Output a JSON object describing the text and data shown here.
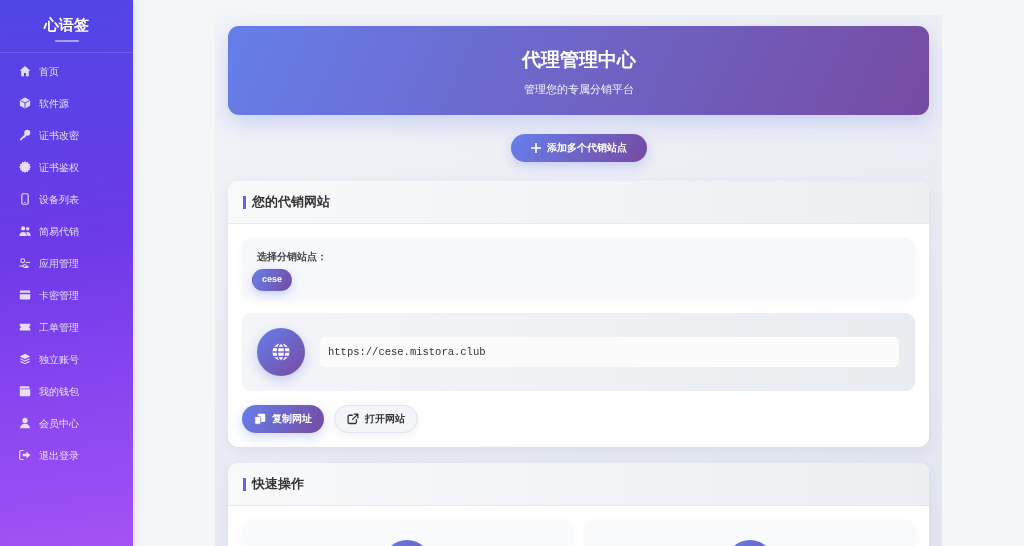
{
  "sidebar": {
    "brand": "心语签",
    "items": [
      {
        "label": "首页",
        "selected": false
      },
      {
        "label": "软件源",
        "selected": false
      },
      {
        "label": "证书改密",
        "selected": false
      },
      {
        "label": "证书鉴权",
        "selected": false
      },
      {
        "label": "设备列表",
        "selected": false
      },
      {
        "label": "简易代销",
        "selected": false
      },
      {
        "label": "应用管理",
        "selected": false
      },
      {
        "label": "卡密管理",
        "selected": false
      },
      {
        "label": "工单管理",
        "selected": false
      },
      {
        "label": "独立账号",
        "selected": false
      },
      {
        "label": "我的钱包",
        "selected": false
      },
      {
        "label": "会员中心",
        "selected": false
      },
      {
        "label": "退出登录",
        "selected": false
      }
    ]
  },
  "header": {
    "title": "代理管理中心",
    "subtitle": "管理您的专属分销平台"
  },
  "add_button": {
    "label": "添加多个代销站点"
  },
  "sites_card": {
    "title": "您的代销网站",
    "select_label": "选择分销站点：",
    "sites": [
      {
        "label": "cese",
        "selected": true
      }
    ],
    "url": "https://cese.mistora.club",
    "buttons": [
      {
        "label": "复制网址",
        "kind": "primary"
      },
      {
        "label": "打开网站",
        "kind": "secondary"
      }
    ]
  },
  "quick_card": {
    "title": "快速操作"
  }
}
